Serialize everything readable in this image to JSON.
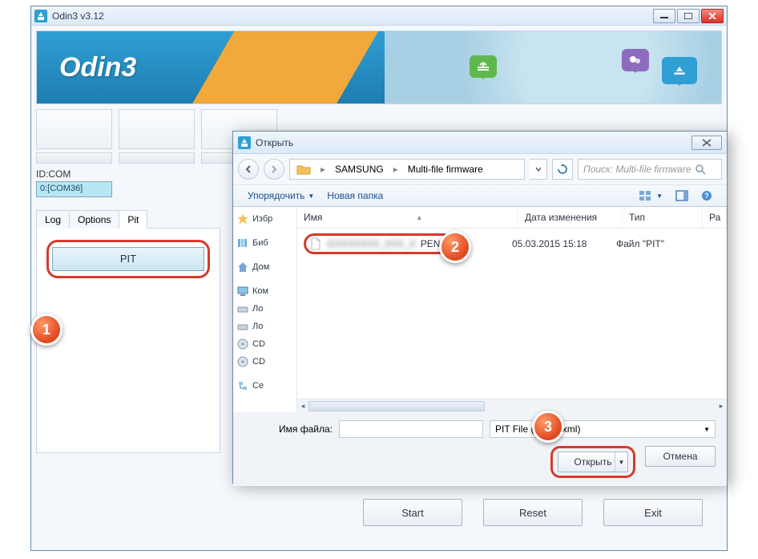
{
  "window": {
    "title": "Odin3 v3.12",
    "logo": "Odin3"
  },
  "idcom": {
    "label": "ID:COM",
    "value": "0:[COM36]"
  },
  "tabs": {
    "log": "Log",
    "options": "Options",
    "pit": "Pit"
  },
  "pit_button": "PIT",
  "bottom": {
    "start": "Start",
    "reset": "Reset",
    "exit": "Exit"
  },
  "dialog": {
    "title": "Открыть",
    "breadcrumb": {
      "seg1": "SAMSUNG",
      "seg2": "Multi-file firmware"
    },
    "search_placeholder": "Поиск: Multi-file firmware",
    "toolbar": {
      "organize": "Упорядочить",
      "newfolder": "Новая папка"
    },
    "nav": {
      "fav": "Избр",
      "lib": "Биб",
      "home": "Дом",
      "comp": "Ком",
      "local1": "Ло",
      "local2": "Ло",
      "cd1": "CD",
      "cd2": "CD",
      "net": "Се"
    },
    "columns": {
      "name": "Имя",
      "date": "Дата изменения",
      "type": "Тип",
      "size": "Ра"
    },
    "file": {
      "name_suffix": "PEN.pit",
      "date": "05.03.2015 15:18",
      "type": "Файл \"PIT\""
    },
    "filename_label": "Имя файла:",
    "filter": "PIT File (*.pit, *.xml)",
    "open": "Открыть",
    "cancel": "Отмена"
  },
  "badges": {
    "one": "1",
    "two": "2",
    "three": "3"
  }
}
